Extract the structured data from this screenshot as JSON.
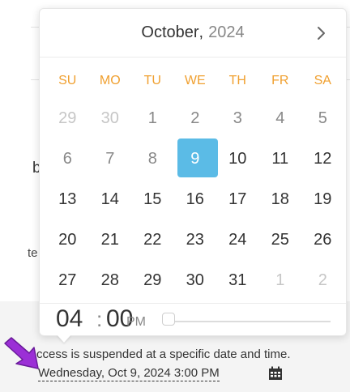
{
  "background": {
    "frag_b": "b",
    "frag_te": "te"
  },
  "calendar": {
    "month": "October",
    "comma": ",",
    "year": "2024",
    "weekdays": [
      "SU",
      "MO",
      "TU",
      "WE",
      "TH",
      "FR",
      "SA"
    ],
    "days": [
      {
        "label": "29",
        "state": "muted"
      },
      {
        "label": "30",
        "state": "muted"
      },
      {
        "label": "1",
        "state": "gray"
      },
      {
        "label": "2",
        "state": "gray"
      },
      {
        "label": "3",
        "state": "gray"
      },
      {
        "label": "4",
        "state": "gray"
      },
      {
        "label": "5",
        "state": "gray"
      },
      {
        "label": "6",
        "state": "gray"
      },
      {
        "label": "7",
        "state": "gray"
      },
      {
        "label": "8",
        "state": "gray"
      },
      {
        "label": "9",
        "state": "selected"
      },
      {
        "label": "10",
        "state": "normal"
      },
      {
        "label": "11",
        "state": "normal"
      },
      {
        "label": "12",
        "state": "normal"
      },
      {
        "label": "13",
        "state": "normal"
      },
      {
        "label": "14",
        "state": "normal"
      },
      {
        "label": "15",
        "state": "normal"
      },
      {
        "label": "16",
        "state": "normal"
      },
      {
        "label": "17",
        "state": "normal"
      },
      {
        "label": "18",
        "state": "normal"
      },
      {
        "label": "19",
        "state": "normal"
      },
      {
        "label": "20",
        "state": "normal"
      },
      {
        "label": "21",
        "state": "normal"
      },
      {
        "label": "22",
        "state": "normal"
      },
      {
        "label": "23",
        "state": "normal"
      },
      {
        "label": "24",
        "state": "normal"
      },
      {
        "label": "25",
        "state": "normal"
      },
      {
        "label": "26",
        "state": "normal"
      },
      {
        "label": "27",
        "state": "normal"
      },
      {
        "label": "28",
        "state": "normal"
      },
      {
        "label": "29",
        "state": "normal"
      },
      {
        "label": "30",
        "state": "normal"
      },
      {
        "label": "31",
        "state": "normal"
      },
      {
        "label": "1",
        "state": "muted"
      },
      {
        "label": "2",
        "state": "muted"
      }
    ],
    "time": {
      "hour": "04",
      "colon": ":",
      "minute": "00",
      "ampm": "PM",
      "slider_value": 0
    }
  },
  "access_text": "ccess is suspended at a specific date and time.",
  "datetime_value": "Wednesday, Oct 9, 2024 3:00 PM",
  "colors": {
    "accent": "#5bbbe6",
    "weekday": "#f0a030",
    "annotation_arrow": "#9b2fd6"
  },
  "icons": {
    "next": "chevron-right-icon",
    "calendar": "calendar-icon",
    "annotation": "arrow-annotation-icon"
  }
}
